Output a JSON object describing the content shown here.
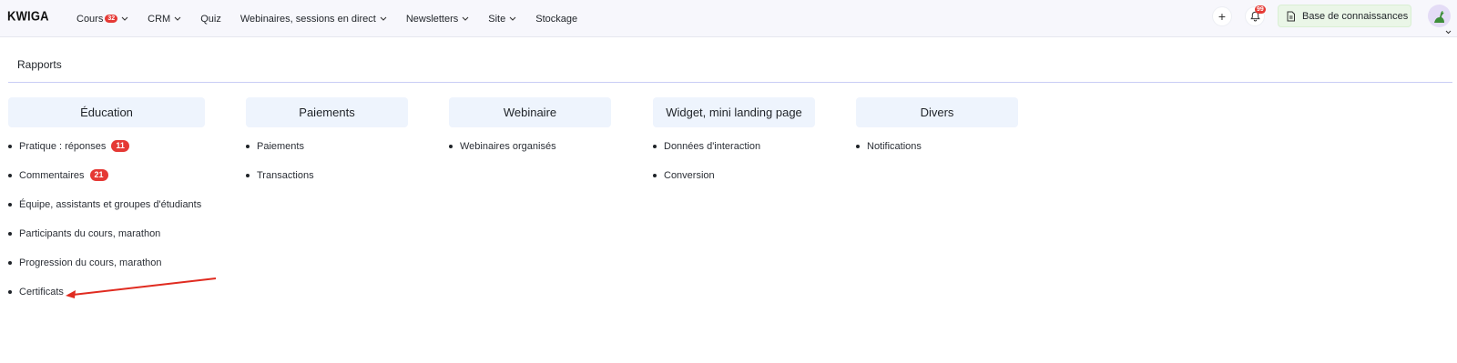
{
  "brand": {
    "logo": "KWIGA"
  },
  "nav": {
    "items": [
      {
        "label": "Cours",
        "badge": "32",
        "dropdown": true
      },
      {
        "label": "CRM",
        "dropdown": true
      },
      {
        "label": "Quiz",
        "dropdown": false
      },
      {
        "label": "Webinaires, sessions en direct",
        "dropdown": true
      },
      {
        "label": "Newsletters",
        "dropdown": true
      },
      {
        "label": "Site",
        "dropdown": true
      },
      {
        "label": "Stockage",
        "dropdown": false
      }
    ],
    "plus_icon": "plus-icon",
    "notifications_badge": "99",
    "knowledge_base_label": "Base de connaissances"
  },
  "page": {
    "title": "Rapports",
    "columns": [
      {
        "heading": "Éducation",
        "items": [
          {
            "label": "Pratique : réponses",
            "count": "11"
          },
          {
            "label": "Commentaires",
            "count": "21"
          },
          {
            "label": "Équipe, assistants et groupes d'étudiants"
          },
          {
            "label": "Participants du cours, marathon"
          },
          {
            "label": "Progression du cours, marathon"
          },
          {
            "label": "Certificats"
          }
        ]
      },
      {
        "heading": "Paiements",
        "items": [
          {
            "label": "Paiements"
          },
          {
            "label": "Transactions"
          }
        ]
      },
      {
        "heading": "Webinaire",
        "items": [
          {
            "label": "Webinaires organisés"
          }
        ]
      },
      {
        "heading": "Widget, mini landing page",
        "items": [
          {
            "label": "Données d'interaction"
          },
          {
            "label": "Conversion"
          }
        ]
      },
      {
        "heading": "Divers",
        "items": [
          {
            "label": "Notifications"
          }
        ]
      }
    ]
  },
  "colors": {
    "accent_red": "#e53935",
    "annotation_arrow": "#e02b20"
  }
}
